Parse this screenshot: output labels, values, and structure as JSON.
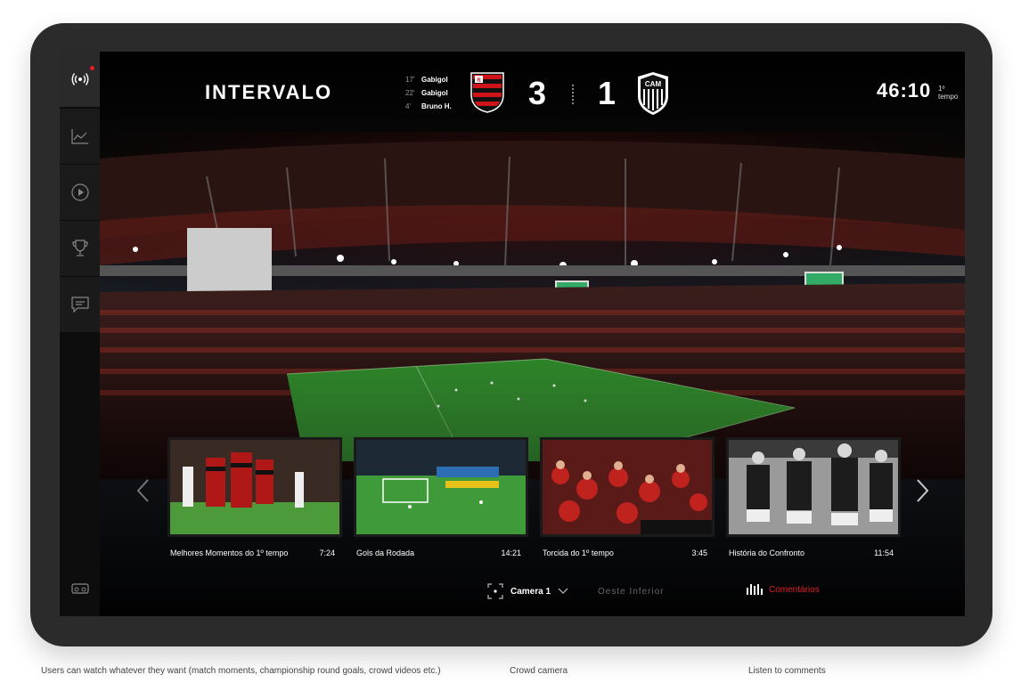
{
  "match": {
    "status": "INTERVALO",
    "scorers": [
      {
        "minute": "17'",
        "name": "Gabigol"
      },
      {
        "minute": "22'",
        "name": "Gabigol"
      },
      {
        "minute": "4'",
        "name": "Bruno H."
      }
    ],
    "home_score": "3",
    "away_score": "1",
    "away_crest_text": "CAM",
    "clock": "46:10",
    "period": "1º tempo"
  },
  "sidebar": {
    "items": [
      {
        "icon": "live-broadcast-icon"
      },
      {
        "icon": "stats-chart-icon"
      },
      {
        "icon": "play-icon"
      },
      {
        "icon": "trophy-icon"
      },
      {
        "icon": "chat-icon"
      }
    ],
    "bottom_icon": "vr-headset-icon"
  },
  "videos": [
    {
      "title": "Melhores Momentos do 1º tempo",
      "duration": "7:24"
    },
    {
      "title": "Gols da Rodada",
      "duration": "14:21"
    },
    {
      "title": "Torcida do 1º tempo",
      "duration": "3:45"
    },
    {
      "title": "História do Confronto",
      "duration": "11:54"
    }
  ],
  "bottom_bar": {
    "camera_label": "Camera 1",
    "camera_area": "Oeste Inferior",
    "comments_label": "Comentários"
  },
  "captions": {
    "left": "Users can watch whatever they want (match moments, championship round goals, crowd videos etc.)",
    "center": "Crowd camera",
    "right": "Listen to comments"
  },
  "colors": {
    "accent_red": "#e11d2a",
    "device_frame": "#2b2b2b",
    "pitch_green": "#2f8a2a"
  }
}
